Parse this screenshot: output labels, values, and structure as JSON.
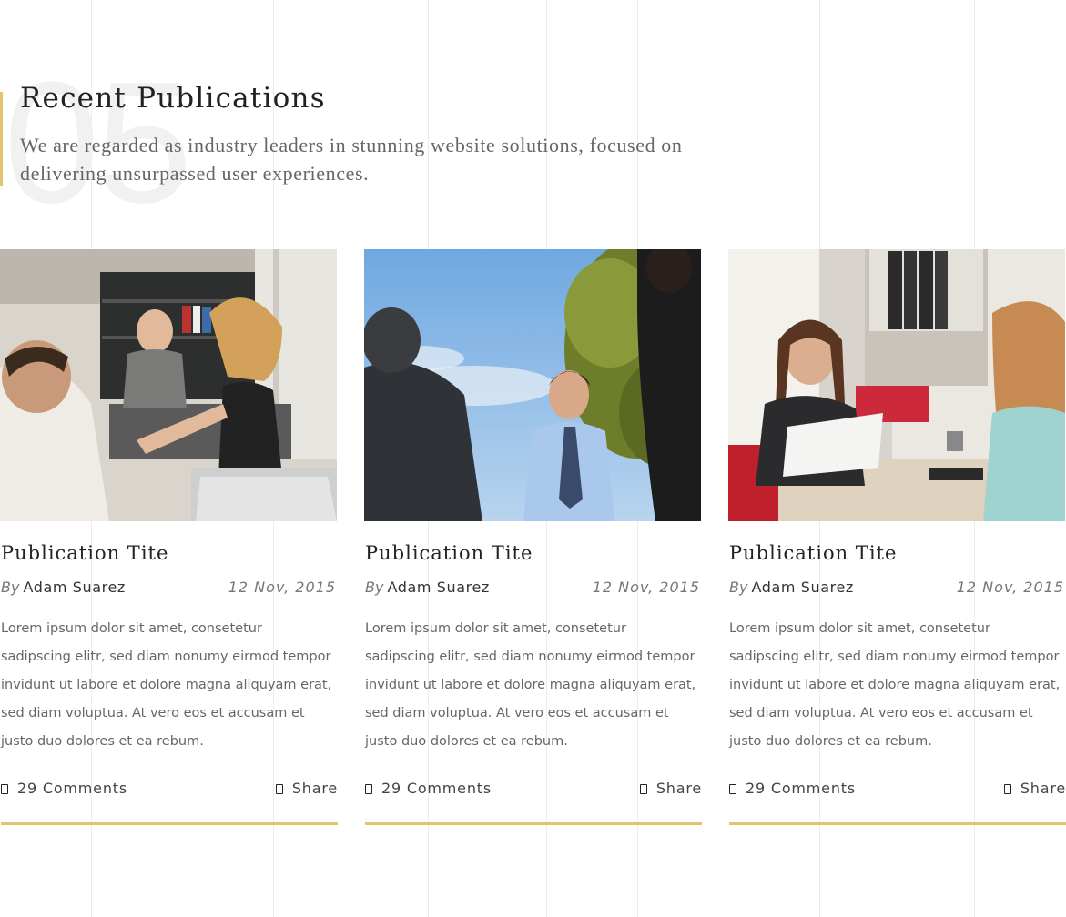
{
  "section": {
    "number": "05",
    "title": "Recent Publications",
    "subtitle": "We are regarded as industry leaders in stunning website solutions, focused on delivering unsurpassed user experiences."
  },
  "colors": {
    "accent": "#e3c36c",
    "heading": "#222222",
    "body_text": "#666666",
    "watermark_number": "#f1f1f1"
  },
  "publications": [
    {
      "image_alt": "Business meeting argument in office",
      "title": "Publication Tite",
      "by_label": "By",
      "author": "Adam Suarez",
      "date": "12 Nov, 2015",
      "excerpt": "Lorem ipsum dolor sit amet, consetetur sadipscing elitr, sed diam nonumy eirmod tempor invidunt ut labore et dolore magna aliquyam erat, sed diam voluptua. At vero eos et accusam et justo duo dolores et ea rebum.",
      "comments_label": "29 Comments",
      "comments_icon": "comment-icon",
      "share_label": "Share",
      "share_icon": "share-icon"
    },
    {
      "image_alt": "Man in shirt and tie outdoors",
      "title": "Publication Tite",
      "by_label": "By",
      "author": "Adam Suarez",
      "date": "12 Nov, 2015",
      "excerpt": "Lorem ipsum dolor sit amet, consetetur sadipscing elitr, sed diam nonumy eirmod tempor invidunt ut labore et dolore magna aliquyam erat, sed diam voluptua. At vero eos et accusam et justo duo dolores et ea rebum.",
      "comments_label": "29 Comments",
      "comments_icon": "comment-icon",
      "share_label": "Share",
      "share_icon": "share-icon"
    },
    {
      "image_alt": "Two women at office desk",
      "title": "Publication Tite",
      "by_label": "By",
      "author": "Adam Suarez",
      "date": "12 Nov, 2015",
      "excerpt": "Lorem ipsum dolor sit amet, consetetur sadipscing elitr, sed diam nonumy eirmod tempor invidunt ut labore et dolore magna aliquyam erat, sed diam voluptua. At vero eos et accusam et justo duo dolores et ea rebum.",
      "comments_label": "29 Comments",
      "comments_icon": "comment-icon",
      "share_label": "Share",
      "share_icon": "share-icon"
    }
  ]
}
